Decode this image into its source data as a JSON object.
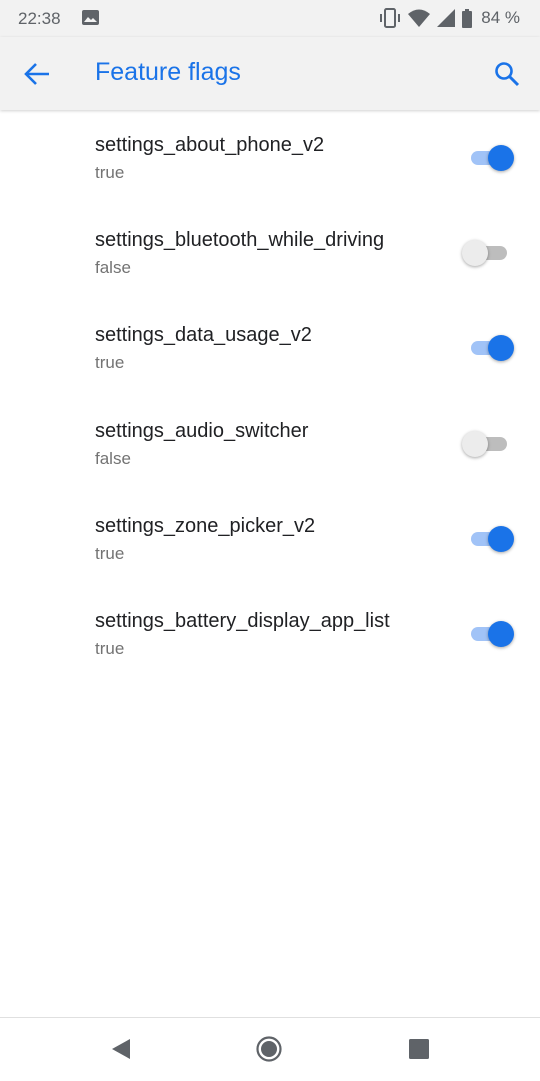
{
  "status_bar": {
    "time": "22:38",
    "battery": "84 %",
    "icons": [
      "image-icon",
      "vibrate-icon",
      "wifi-icon",
      "signal-icon",
      "battery-icon"
    ]
  },
  "app_bar": {
    "title": "Feature flags",
    "back_icon": "arrow-back-icon",
    "search_icon": "search-icon"
  },
  "colors": {
    "accent": "#1a73e8",
    "switch_on_track": "#a1c3f7",
    "switch_off_thumb": "#ececec",
    "switch_off_track": "#bdbdbd"
  },
  "flags": [
    {
      "name": "settings_about_phone_v2",
      "value": "true",
      "enabled": true
    },
    {
      "name": "settings_bluetooth_while_driving",
      "value": "false",
      "enabled": false
    },
    {
      "name": "settings_data_usage_v2",
      "value": "true",
      "enabled": true
    },
    {
      "name": "settings_audio_switcher",
      "value": "false",
      "enabled": false
    },
    {
      "name": "settings_zone_picker_v2",
      "value": "true",
      "enabled": true
    },
    {
      "name": "settings_battery_display_app_list",
      "value": "true",
      "enabled": true
    }
  ],
  "nav_bar": {
    "icons": [
      "nav-back-icon",
      "nav-home-icon",
      "nav-recents-icon"
    ]
  }
}
